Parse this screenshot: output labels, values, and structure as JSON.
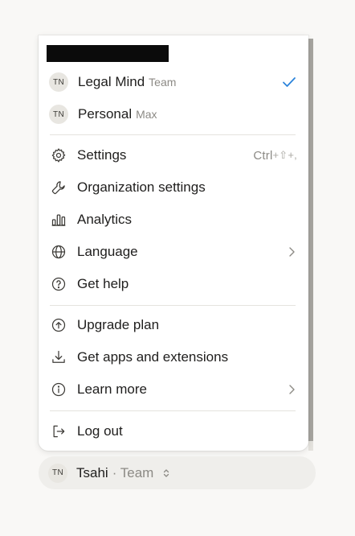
{
  "accounts": [
    {
      "initials": "TN",
      "name": "Legal Mind",
      "plan": "Team",
      "selected": true
    },
    {
      "initials": "TN",
      "name": "Personal",
      "plan": "Max",
      "selected": false
    }
  ],
  "menu": {
    "settings": {
      "label": "Settings",
      "shortcut_ctrl": "Ctrl",
      "shortcut_rest": "+⇧+,",
      "icon": "gear-icon"
    },
    "org_settings": {
      "label": "Organization settings",
      "icon": "wrench-icon"
    },
    "analytics": {
      "label": "Analytics",
      "icon": "bar-chart-icon"
    },
    "language": {
      "label": "Language",
      "icon": "globe-icon"
    },
    "help": {
      "label": "Get help",
      "icon": "help-circle-icon"
    },
    "upgrade": {
      "label": "Upgrade plan",
      "icon": "arrow-up-circle-icon"
    },
    "apps": {
      "label": "Get apps and extensions",
      "icon": "download-icon"
    },
    "learn": {
      "label": "Learn more",
      "icon": "info-circle-icon"
    },
    "logout": {
      "label": "Log out",
      "icon": "logout-icon"
    }
  },
  "footer": {
    "initials": "TN",
    "name": "Tsahi",
    "plan": "· Team"
  },
  "colors": {
    "accent_check": "#2c84db",
    "menu_bg": "#ffffff",
    "page_bg": "#f9f8f6",
    "footer_bg": "#efeeeb"
  }
}
